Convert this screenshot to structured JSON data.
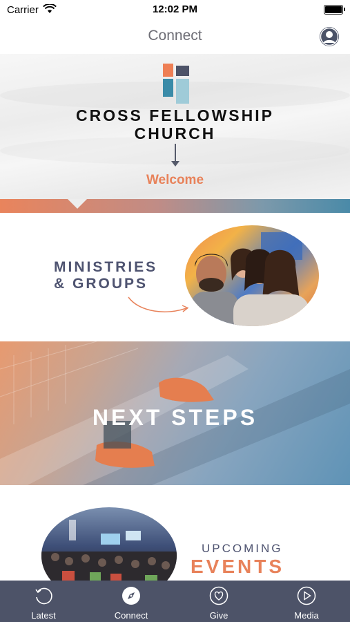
{
  "status_bar": {
    "carrier": "Carrier",
    "time": "12:02 PM"
  },
  "nav": {
    "title": "Connect",
    "profile_icon": "person-circle-icon"
  },
  "hero": {
    "church_name_line1": "CROSS FELLOWSHIP",
    "church_name_line2": "CHURCH",
    "welcome": "Welcome",
    "logo_colors": [
      "#ee7f55",
      "#4d5368",
      "#3a8ba8",
      "#9fcbd8"
    ]
  },
  "ministries": {
    "title_line1": "MINISTRIES",
    "title_line2": "& GROUPS"
  },
  "next_steps": {
    "title": "NEXT STEPS"
  },
  "events": {
    "title_line1": "UPCOMING",
    "title_line2": "EVENTS"
  },
  "tabs": [
    {
      "label": "Latest",
      "icon": "history-icon"
    },
    {
      "label": "Connect",
      "icon": "compass-icon",
      "active": true
    },
    {
      "label": "Give",
      "icon": "heart-icon"
    },
    {
      "label": "Media",
      "icon": "play-icon"
    }
  ],
  "colors": {
    "accent": "#e8825a",
    "navy": "#4d5368",
    "teal": "#4a8aa8"
  }
}
